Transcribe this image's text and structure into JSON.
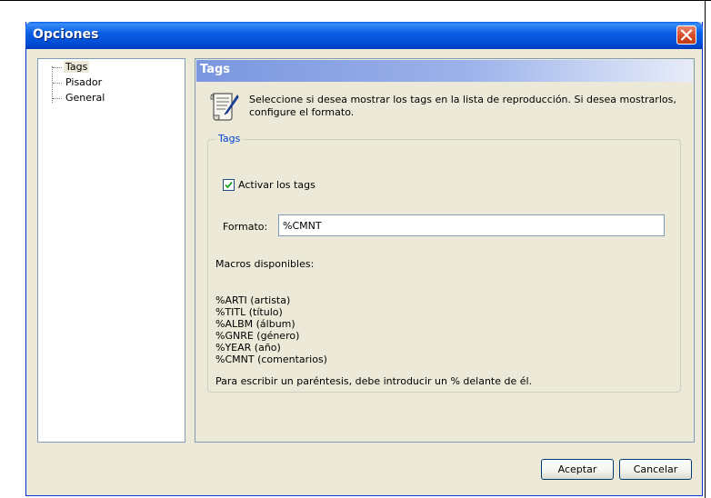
{
  "window": {
    "title": "Opciones"
  },
  "tree": {
    "items": [
      {
        "label": "Tags",
        "selected": true
      },
      {
        "label": "Pisador",
        "selected": false
      },
      {
        "label": "General",
        "selected": false
      }
    ]
  },
  "content": {
    "header": "Tags",
    "description": "Seleccione si desea mostrar los tags en la lista de reproducción. Si desea mostrarlos, configure el formato.",
    "icon": "document-quill-icon"
  },
  "tags_group": {
    "legend": "Tags",
    "enable_tags_label": "Activar los tags",
    "enable_tags_checked": true,
    "format_label": "Formato:",
    "format_value": "%CMNT",
    "macros_title": "Macros disponibles:",
    "macros": [
      "%ARTI (artista)",
      "%TITL (título)",
      "%ALBM (álbum)",
      "%GNRE (género)",
      "%YEAR (año)",
      "%CMNT (comentarios)"
    ],
    "paren_note": "Para escribir un paréntesis, debe introducir un % delante de él."
  },
  "buttons": {
    "accept": "Aceptar",
    "cancel": "Cancelar"
  },
  "colors": {
    "titlebar": "#0054e3",
    "close_button": "#d64b25",
    "group_legend": "#0046d5",
    "dialog_bg": "#ece9d8"
  }
}
